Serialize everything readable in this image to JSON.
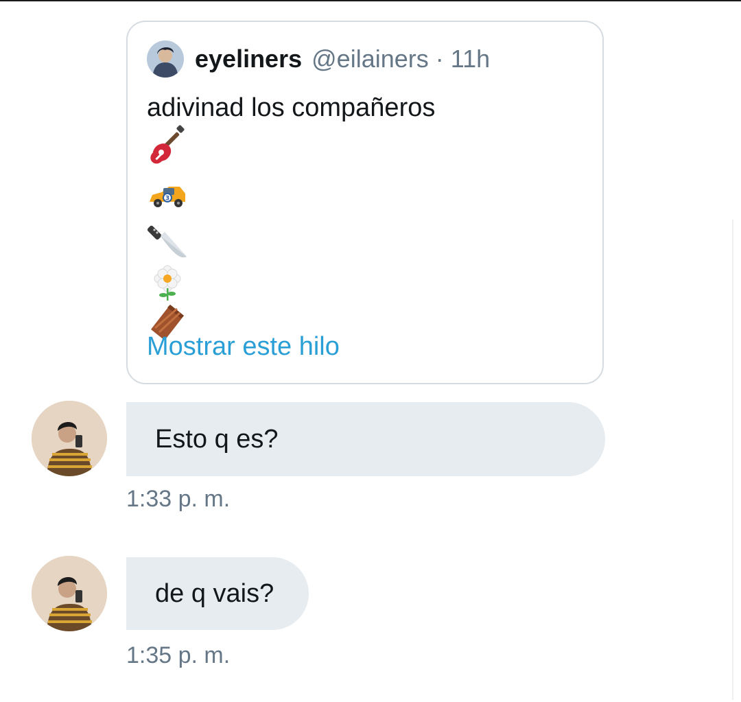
{
  "quoted_tweet": {
    "display_name": "eyeliners",
    "handle_time": "@eilainers · 11h",
    "text": "adivinad los compañeros",
    "emojis": [
      "guitar-icon",
      "race-car-icon",
      "knife-icon",
      "flower-icon",
      "coffin-icon"
    ],
    "thread_link": "Mostrar este hilo"
  },
  "messages": [
    {
      "text": "Esto q es?",
      "time": "1:33 p. m."
    },
    {
      "text": "de q vais?",
      "time": "1:35 p. m."
    }
  ],
  "colors": {
    "link": "#2a9fd6",
    "bubble": "#e6ecf0",
    "muted": "#657786",
    "text": "#14171a"
  }
}
